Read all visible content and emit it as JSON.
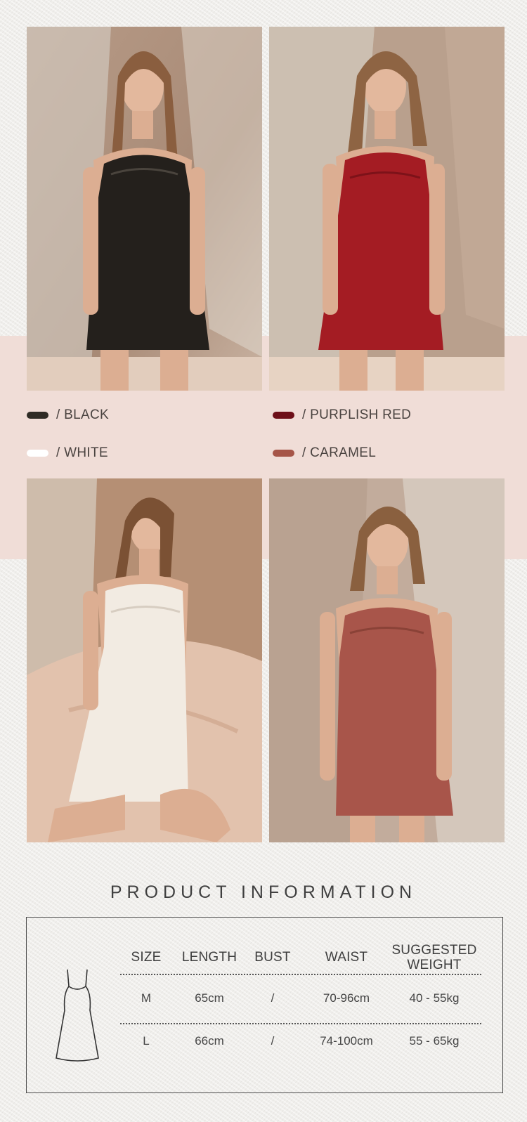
{
  "colors": {
    "swatches": [
      {
        "key": "black",
        "label": "/ BLACK",
        "hex": "#2f2b25"
      },
      {
        "key": "purplish_red",
        "label": "/ PURPLISH RED",
        "hex": "#6d0f18"
      },
      {
        "key": "white",
        "label": "/ WHITE",
        "hex": "#ffffff"
      },
      {
        "key": "caramel",
        "label": "/ CARAMEL",
        "hex": "#a65548"
      }
    ],
    "band": "#f0ddd7"
  },
  "product_information": {
    "title": "PRODUCT INFORMATION",
    "headers": [
      "SIZE",
      "LENGTH",
      "BUST",
      "WAIST",
      "SUGGESTED WEIGHT"
    ],
    "header_lines": {
      "weight_1": "SUGGESTED",
      "weight_2": "WEIGHT"
    },
    "rows": [
      [
        "M",
        "65cm",
        "/",
        "70-96cm",
        "40 - 55kg"
      ],
      [
        "L",
        "66cm",
        "/",
        "74-100cm",
        "55 - 65kg"
      ]
    ],
    "icon": "slip-dress-outline-icon"
  }
}
